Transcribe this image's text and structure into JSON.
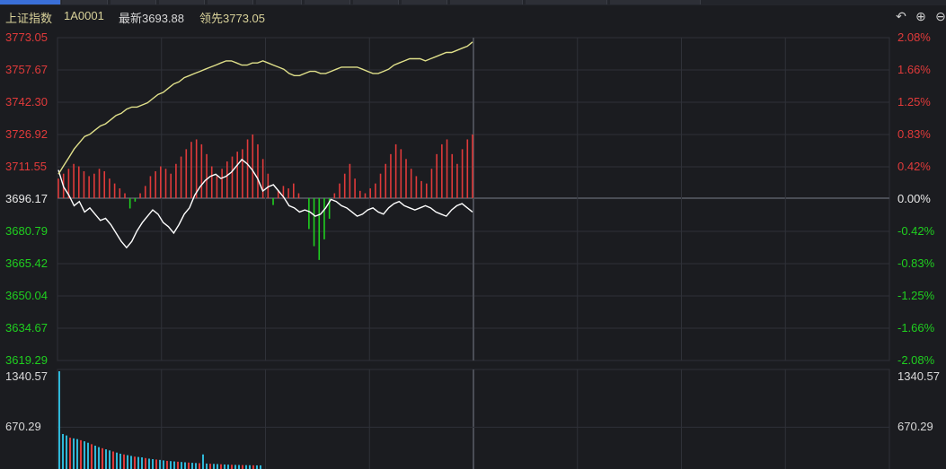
{
  "header": {
    "name": "上证指数",
    "code": "1A0001",
    "latest_label": "最新3693.88",
    "lead_label": "领先3773.05"
  },
  "toolbar_icons": [
    "undo-icon",
    "zoom-in-icon",
    "zoom-out-icon"
  ],
  "colors": {
    "background": "#1b1c20",
    "grid": "#2f3138",
    "up": "#e03a3a",
    "down": "#1fcf1f",
    "flat": "#e8e8e8",
    "index_line": "#ffffff",
    "lead_line": "#e0e08a",
    "volume_up": "#e03a3a",
    "volume_down": "#2fb8d8"
  },
  "price_axis": {
    "left_labels": [
      "3773.05",
      "3757.67",
      "3742.30",
      "3726.92",
      "3711.55",
      "3696.17",
      "3680.79",
      "3665.42",
      "3650.04",
      "3634.67",
      "3619.29"
    ],
    "right_labels": [
      "2.08%",
      "1.66%",
      "1.25%",
      "0.83%",
      "0.42%",
      "0.00%",
      "-0.42%",
      "-0.83%",
      "-1.25%",
      "-1.66%",
      "-2.08%"
    ]
  },
  "volume_axis": {
    "left_labels": [
      "1340.57",
      "670.29"
    ],
    "right_labels": [
      "1340.57",
      "670.29"
    ]
  },
  "chart_data": {
    "type": "line",
    "prev_close": 3696.17,
    "ylim": [
      3619.29,
      3773.05
    ],
    "total_minutes": 240,
    "elapsed_minutes": 120,
    "series": [
      {
        "id": "index",
        "values": [
          3710,
          3702,
          3698,
          3693,
          3695,
          3690,
          3692,
          3689,
          3686,
          3687,
          3684,
          3680,
          3676,
          3673,
          3676,
          3681,
          3685,
          3688,
          3691,
          3689,
          3685,
          3683,
          3680,
          3684,
          3689,
          3692,
          3698,
          3702,
          3705,
          3707,
          3708,
          3706,
          3707,
          3709,
          3712,
          3715,
          3713,
          3710,
          3706,
          3700,
          3702,
          3703,
          3700,
          3697,
          3693,
          3692,
          3690,
          3691,
          3690,
          3688,
          3689,
          3692,
          3696,
          3695,
          3693,
          3692,
          3690,
          3688,
          3689,
          3691,
          3692,
          3690,
          3689,
          3692,
          3694,
          3695,
          3693,
          3692,
          3691,
          3692,
          3693,
          3692,
          3690,
          3689,
          3688,
          3691,
          3693,
          3694,
          3692,
          3690
        ]
      },
      {
        "id": "lead",
        "values": [
          3708,
          3712,
          3716,
          3720,
          3723,
          3726,
          3727,
          3729,
          3731,
          3732,
          3734,
          3736,
          3737,
          3739,
          3740,
          3740,
          3741,
          3742,
          3744,
          3746,
          3747,
          3749,
          3751,
          3752,
          3754,
          3755,
          3756,
          3757,
          3758,
          3759,
          3760,
          3761,
          3762,
          3762,
          3761,
          3760,
          3760,
          3761,
          3761,
          3762,
          3761,
          3760,
          3759,
          3758,
          3756,
          3755,
          3755,
          3756,
          3757,
          3757,
          3756,
          3756,
          3757,
          3758,
          3759,
          3759,
          3759,
          3759,
          3758,
          3757,
          3756,
          3756,
          3757,
          3758,
          3760,
          3761,
          3762,
          3763,
          3763,
          3763,
          3762,
          3763,
          3764,
          3765,
          3766,
          3766,
          3767,
          3768,
          3769,
          3771
        ]
      }
    ],
    "updown_bars": [
      8,
      10,
      12,
      14,
      13,
      11,
      9,
      10,
      12,
      11,
      8,
      6,
      4,
      2,
      -3,
      -1,
      2,
      5,
      9,
      11,
      13,
      12,
      10,
      14,
      17,
      20,
      23,
      24,
      22,
      18,
      13,
      9,
      12,
      15,
      17,
      19,
      20,
      24,
      26,
      22,
      16,
      10,
      -2,
      3,
      5,
      4,
      6,
      2,
      0,
      -9,
      -14,
      -18,
      -12,
      -6,
      2,
      6,
      10,
      14,
      8,
      3,
      2,
      4,
      6,
      10,
      14,
      18,
      22,
      20,
      16,
      12,
      9,
      7,
      6,
      12,
      18,
      22,
      24,
      18,
      14,
      20,
      24,
      26
    ],
    "volume": [
      1340.57,
      480,
      460,
      430,
      420,
      410,
      395,
      380,
      360,
      340,
      320,
      300,
      285,
      270,
      255,
      240,
      225,
      210,
      200,
      190,
      180,
      170,
      165,
      160,
      150,
      142,
      135,
      130,
      125,
      118,
      112,
      108,
      104,
      100,
      96,
      92,
      88,
      85,
      82,
      80,
      200,
      75,
      72,
      70,
      68,
      65,
      62,
      60,
      58,
      56,
      55,
      54,
      53,
      52,
      51,
      50,
      50
    ]
  }
}
